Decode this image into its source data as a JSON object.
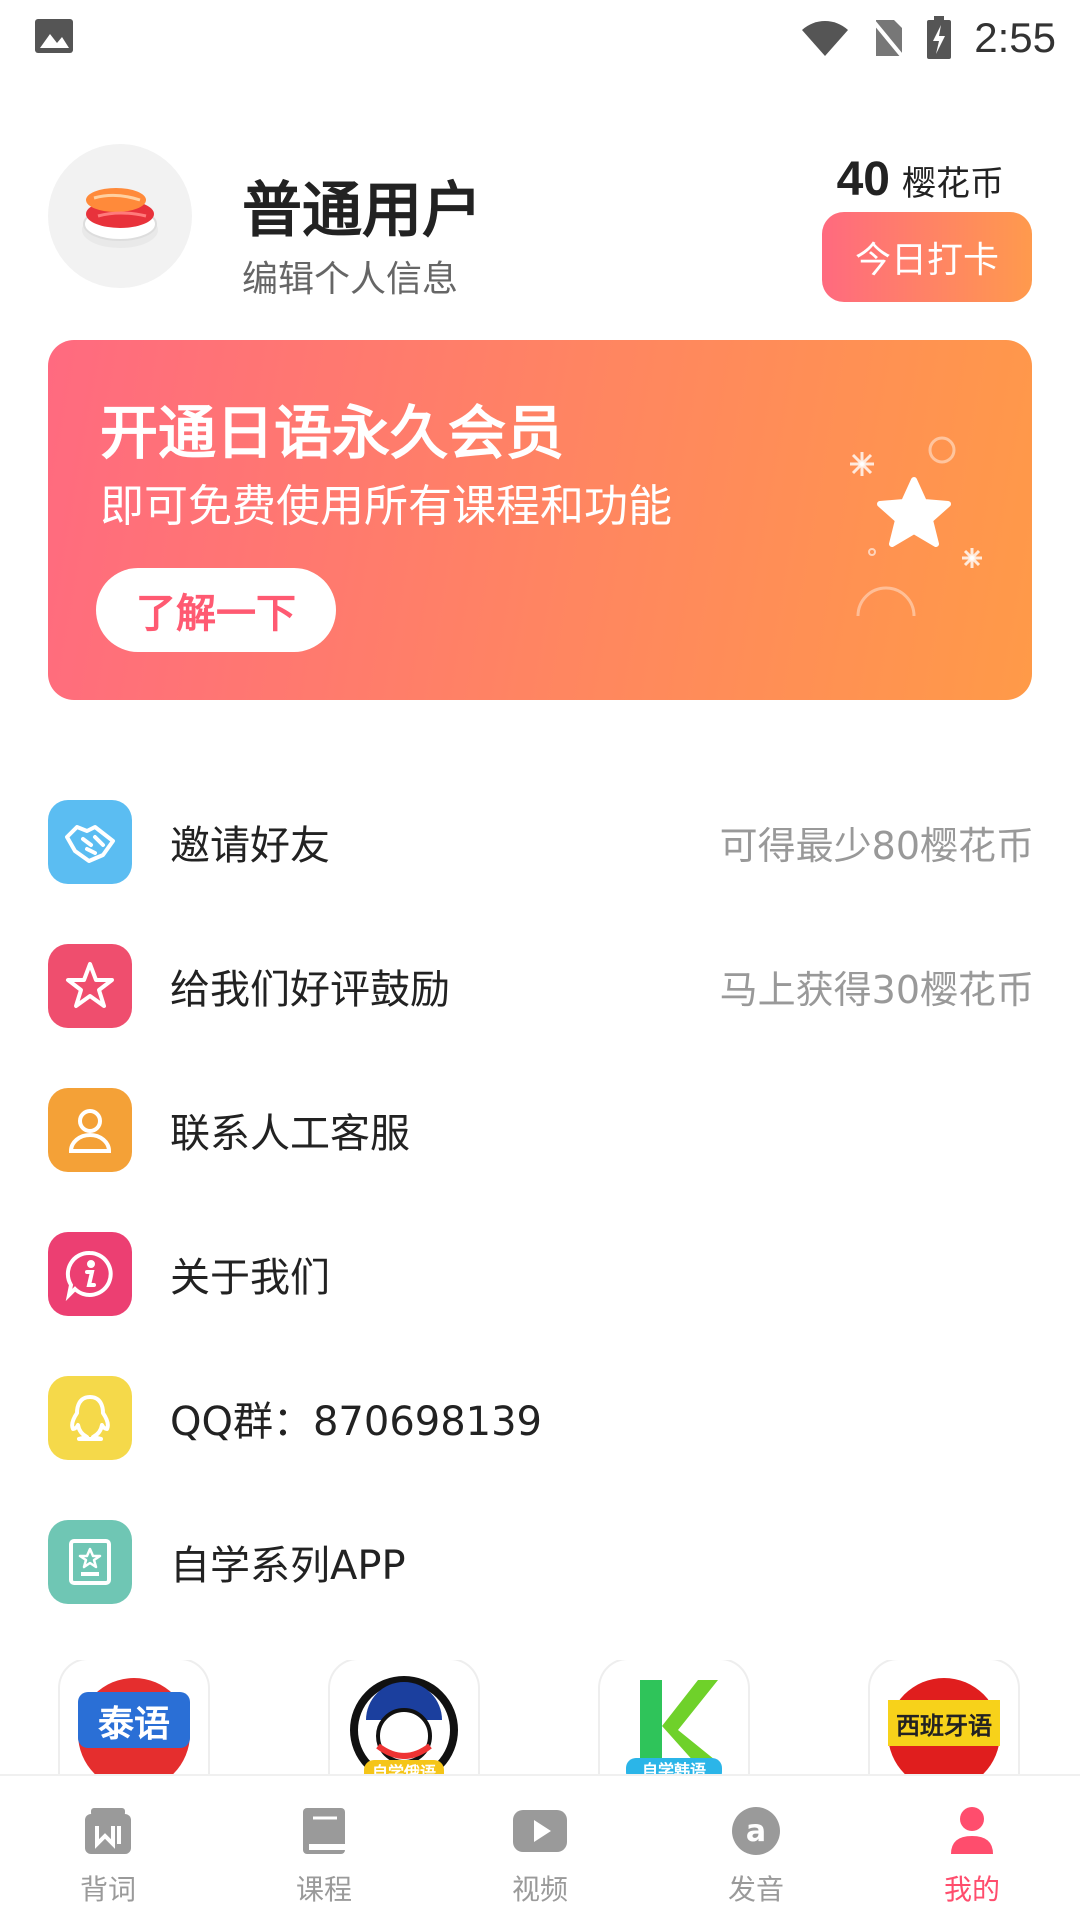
{
  "status_bar": {
    "time": "2:55"
  },
  "profile": {
    "username": "普通用户",
    "edit_label": "编辑个人信息",
    "coins_value": "40",
    "coins_unit": "樱花币",
    "checkin_label": "今日打卡"
  },
  "banner": {
    "title": "开通日语永久会员",
    "subtitle": "即可免费使用所有课程和功能",
    "button_label": "了解一下"
  },
  "menu": [
    {
      "label": "邀请好友",
      "hint": "可得最少80樱花币",
      "icon": "handshake-icon",
      "color": "#5bbdf2"
    },
    {
      "label": "给我们好评鼓励",
      "hint": "马上获得30樱花币",
      "icon": "star-icon",
      "color": "#ef4e6e"
    },
    {
      "label": "联系人工客服",
      "hint": "",
      "icon": "user-icon",
      "color": "#f4a137"
    },
    {
      "label": "关于我们",
      "hint": "",
      "icon": "info-icon",
      "color": "#ec3f72"
    },
    {
      "label": "QQ群：870698139",
      "hint": "",
      "icon": "qq-icon",
      "color": "#f5d94a"
    },
    {
      "label": "自学系列APP",
      "hint": "",
      "icon": "certificate-icon",
      "color": "#6fc6b4"
    }
  ],
  "apps": [
    {
      "name": "泰语-app-icon",
      "label": "泰语"
    },
    {
      "name": "俄语-app-icon",
      "label": "自学俄语"
    },
    {
      "name": "韩语-app-icon",
      "label": "自学韩语"
    },
    {
      "name": "西班牙语-app-icon",
      "label": "西班牙语"
    }
  ],
  "tabs": [
    {
      "label": "背词",
      "icon": "flashcard-icon",
      "active": false
    },
    {
      "label": "课程",
      "icon": "book-icon",
      "active": false
    },
    {
      "label": "视频",
      "icon": "play-icon",
      "active": false
    },
    {
      "label": "发音",
      "icon": "pronunciation-icon",
      "active": false
    },
    {
      "label": "我的",
      "icon": "profile-icon",
      "active": true
    }
  ],
  "colors": {
    "accent": "#ff4d6d",
    "banner_start": "#ff6a80",
    "banner_end": "#ff9a48",
    "tab_inactive": "#9a9a9a"
  }
}
